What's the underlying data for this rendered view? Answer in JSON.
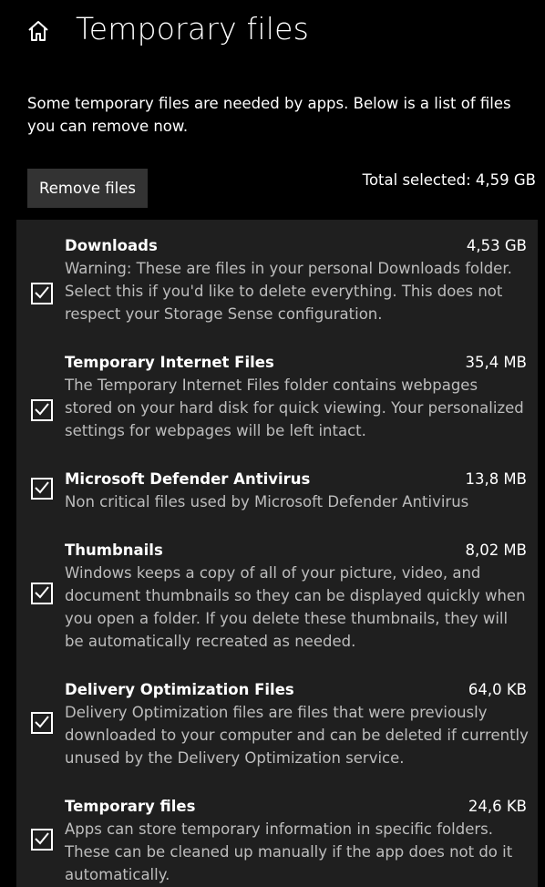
{
  "header": {
    "title": "Temporary files",
    "home_icon": "home-icon"
  },
  "intro": "Some temporary files are needed by apps. Below is a list of files you can remove now.",
  "remove_button": "Remove files",
  "total_selected": "Total selected: 4,59 GB",
  "items": [
    {
      "name": "Downloads",
      "size": "4,53 GB",
      "checked": true,
      "description": "Warning: These are files in your personal Downloads folder. Select this if you'd like to delete everything. This does not respect your Storage Sense configuration."
    },
    {
      "name": "Temporary Internet Files",
      "size": "35,4 MB",
      "checked": true,
      "description": "The Temporary Internet Files folder contains webpages stored on your hard disk for quick viewing. Your personalized settings for webpages will be left intact."
    },
    {
      "name": "Microsoft Defender Antivirus",
      "size": "13,8 MB",
      "checked": true,
      "description": "Non critical files used by Microsoft Defender Antivirus"
    },
    {
      "name": "Thumbnails",
      "size": "8,02 MB",
      "checked": true,
      "description": "Windows keeps a copy of all of your picture, video, and document thumbnails so they can be displayed quickly when you open a folder. If you delete these thumbnails, they will be automatically recreated as needed."
    },
    {
      "name": "Delivery Optimization Files",
      "size": "64,0 KB",
      "checked": true,
      "description": "Delivery Optimization files are files that were previously downloaded to your computer and can be deleted if currently unused by the Delivery Optimization service."
    },
    {
      "name": "Temporary files",
      "size": "24,6 KB",
      "checked": true,
      "description": "Apps can store temporary information in specific folders. These can be cleaned up manually if the app does not do it automatically."
    }
  ],
  "colors": {
    "background": "#000000",
    "list_background": "#1f1f1f",
    "button_background": "#333333",
    "description_text": "#bdbdbd",
    "text": "#ffffff"
  }
}
